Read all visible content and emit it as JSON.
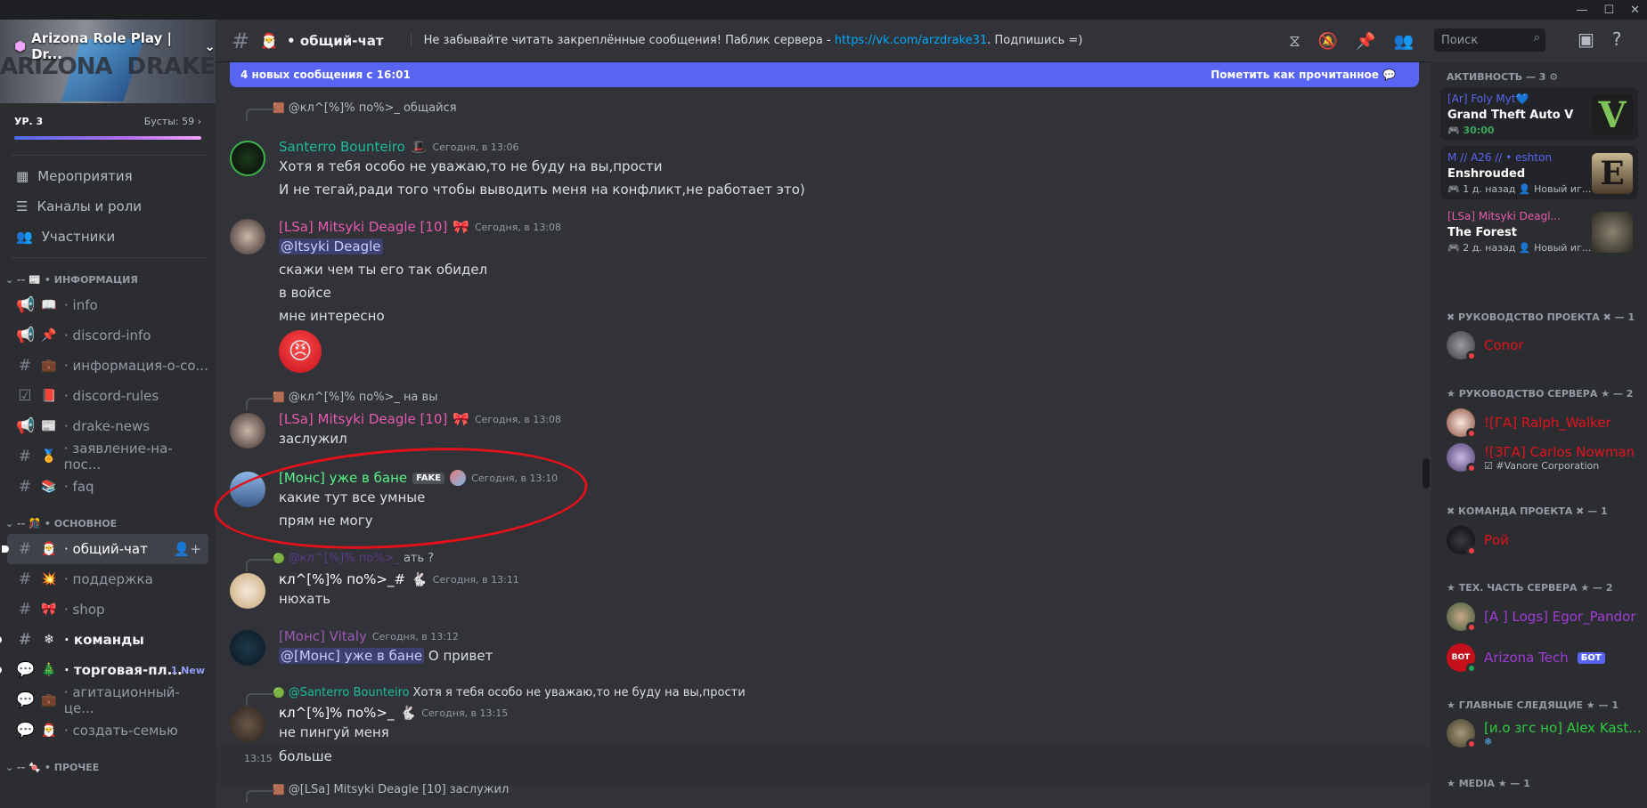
{
  "window": {
    "minimize": "—",
    "maximize": "☐",
    "close": "✕"
  },
  "server": {
    "name": "Arizona Role Play | Dr...",
    "banner_left": "ARIZONA",
    "banner_right": "DRAKE",
    "level": "УР. 3",
    "boosts": "Бусты: 59"
  },
  "menu": [
    {
      "label": "Мероприятия",
      "icon": "calendar-icon"
    },
    {
      "label": "Каналы и роли",
      "icon": "channels-icon"
    },
    {
      "label": "Участники",
      "icon": "members-icon"
    }
  ],
  "categories": {
    "info": "• ИНФОРМАЦИЯ",
    "main": "• ОСНОВНОЕ",
    "other": "• ПРОЧЕЕ"
  },
  "channels_info": [
    {
      "name": "info",
      "emoji": "📖"
    },
    {
      "name": "discord-info",
      "emoji": "📌"
    },
    {
      "name": "информация-о-со...",
      "emoji": "💼"
    },
    {
      "name": "discord-rules",
      "emoji": "📕"
    },
    {
      "name": "drake-news",
      "emoji": "📰"
    },
    {
      "name": "заявление-на-пос...",
      "emoji": "🏅"
    },
    {
      "name": "faq",
      "emoji": "📚"
    }
  ],
  "channels_main": [
    {
      "name": "общий-чат",
      "emoji": "🎅"
    },
    {
      "name": "поддержка",
      "emoji": "💥"
    },
    {
      "name": "shop",
      "emoji": "🎀"
    },
    {
      "name": "команды",
      "emoji": "❄"
    },
    {
      "name": "торговая-пл...",
      "emoji": "🎄",
      "badge": "1 New"
    },
    {
      "name": "агитационный-це...",
      "emoji": "💼"
    },
    {
      "name": "создать-семью",
      "emoji": "🎅"
    }
  ],
  "header": {
    "channel": "общий-чат",
    "topic_pre": "Не забывайте читать закреплённые сообщения! Паблик сервера - ",
    "topic_link": "https://vk.com/arzdrake31",
    "topic_post": ". Подпишись =)",
    "search_placeholder": "Поиск"
  },
  "newbar": {
    "text": "4 новых сообщения с 16:01",
    "mark": "Пометить как прочитанное"
  },
  "messages": {
    "m1": {
      "reply_user": "@кл^[%]% по%>_",
      "reply_text": "общайся",
      "user": "Santerro Bounteiro",
      "time": "Сегодня, в 13:06",
      "lines": [
        "Хотя я тебя особо не уважаю,то не буду на вы,прости",
        "И не тегай,ради того чтобы выводить меня на конфликт,не работает это)"
      ]
    },
    "m2": {
      "user": "[LSa] Mitsyki Deagle [10]",
      "time": "Сегодня, в 13:08",
      "mention": "@Itsyki Deagle",
      "lines": [
        "скажи чем ты его так обидел",
        "в войсе",
        "мне интересно"
      ]
    },
    "m3": {
      "reply_user": "@кл^[%]% по%>_",
      "reply_text": "на вы",
      "user": "[LSa] Mitsyki Deagle [10]",
      "time": "Сегодня, в 13:08",
      "lines": [
        "заслужил"
      ]
    },
    "m4": {
      "user": "[Монс] уже в бане",
      "badge": "FAKE",
      "time": "Сегодня, в 13:10",
      "lines": [
        "какие тут все умные",
        "прям не могу"
      ]
    },
    "m5": {
      "reply_user": "@кл^[%]% по%>_",
      "reply_text": "ать ?",
      "user": "кл^[%]% по%>_#",
      "time": "Сегодня, в 13:11",
      "lines": [
        "нюхать"
      ]
    },
    "m6": {
      "user": "[Монс] Vitaly",
      "time": "Сегодня, в 13:12",
      "mention": "@[Монс] уже в бане",
      "text": "О привет"
    },
    "m7": {
      "reply_user": "@Santerro Bounteiro",
      "reply_text": "Хотя я тебя особо не уважаю,то не буду на вы,прости",
      "user": "кл^[%]% по%>_",
      "time": "Сегодня, в 13:15",
      "lines": [
        "не пингуй меня"
      ],
      "cont_time": "13:15",
      "cont": "больше"
    },
    "m8": {
      "reply_user": "@[LSa] Mitsyki Deagle [10]",
      "reply_text": "заслужил"
    }
  },
  "right": {
    "activity_title": "АКТИВНОСТЬ — 3",
    "activities": [
      {
        "who": "[Ar] Foly Myt💙",
        "game": "Grand Theft Auto V",
        "status": "🎮 30:00"
      },
      {
        "who": "M // A26 // • eshton",
        "game": "Enshrouded",
        "status": "🎮 1 д. назад  👤 Новый иг..."
      },
      {
        "who": "[LSa] Mitsyki Deagl...",
        "game": "The Forest",
        "status": "🎮 2 д. назад  👤 Новый иг..."
      }
    ],
    "groups": [
      {
        "title": "✖ РУКОВОДСТВО ПРОЕКТА ✖ — 1",
        "members": [
          {
            "name": "Conor",
            "color": "#e4111b"
          }
        ]
      },
      {
        "title": "★ РУКОВОДСТВО СЕРВЕРА ★ — 2",
        "members": [
          {
            "name": "![ГА] Ralph_Walker",
            "color": "#e4111b"
          },
          {
            "name": "![ЗГА] Carlos Nowman",
            "color": "#e4111b",
            "sub": "☑ #Vanore Corporation"
          }
        ]
      },
      {
        "title": "✖ КОМАНДА ПРОЕКТА ✖ — 1",
        "members": [
          {
            "name": "Рой",
            "color": "#e4111b"
          }
        ]
      },
      {
        "title": "★ ТЕХ. ЧАСТЬ СЕРВЕРА ★ — 2",
        "members": [
          {
            "name": "[A ] Logs] Egor_Pandor",
            "color": "#a23ad8"
          },
          {
            "name": "Arizona Tech",
            "color": "#a23ad8",
            "bot": "БОТ"
          }
        ]
      },
      {
        "title": "★ ГЛАВНЫЕ СЛЕДЯЩИЕ ★ — 1",
        "members": [
          {
            "name": "[и.о згс но] Alex Kast...",
            "color": "#2ecc40",
            "sub": "❄"
          }
        ]
      },
      {
        "title": "★ MEDIA ★ — 1",
        "members": []
      }
    ]
  },
  "reactions": [
    "❤️",
    "👍",
    "⬆️"
  ]
}
